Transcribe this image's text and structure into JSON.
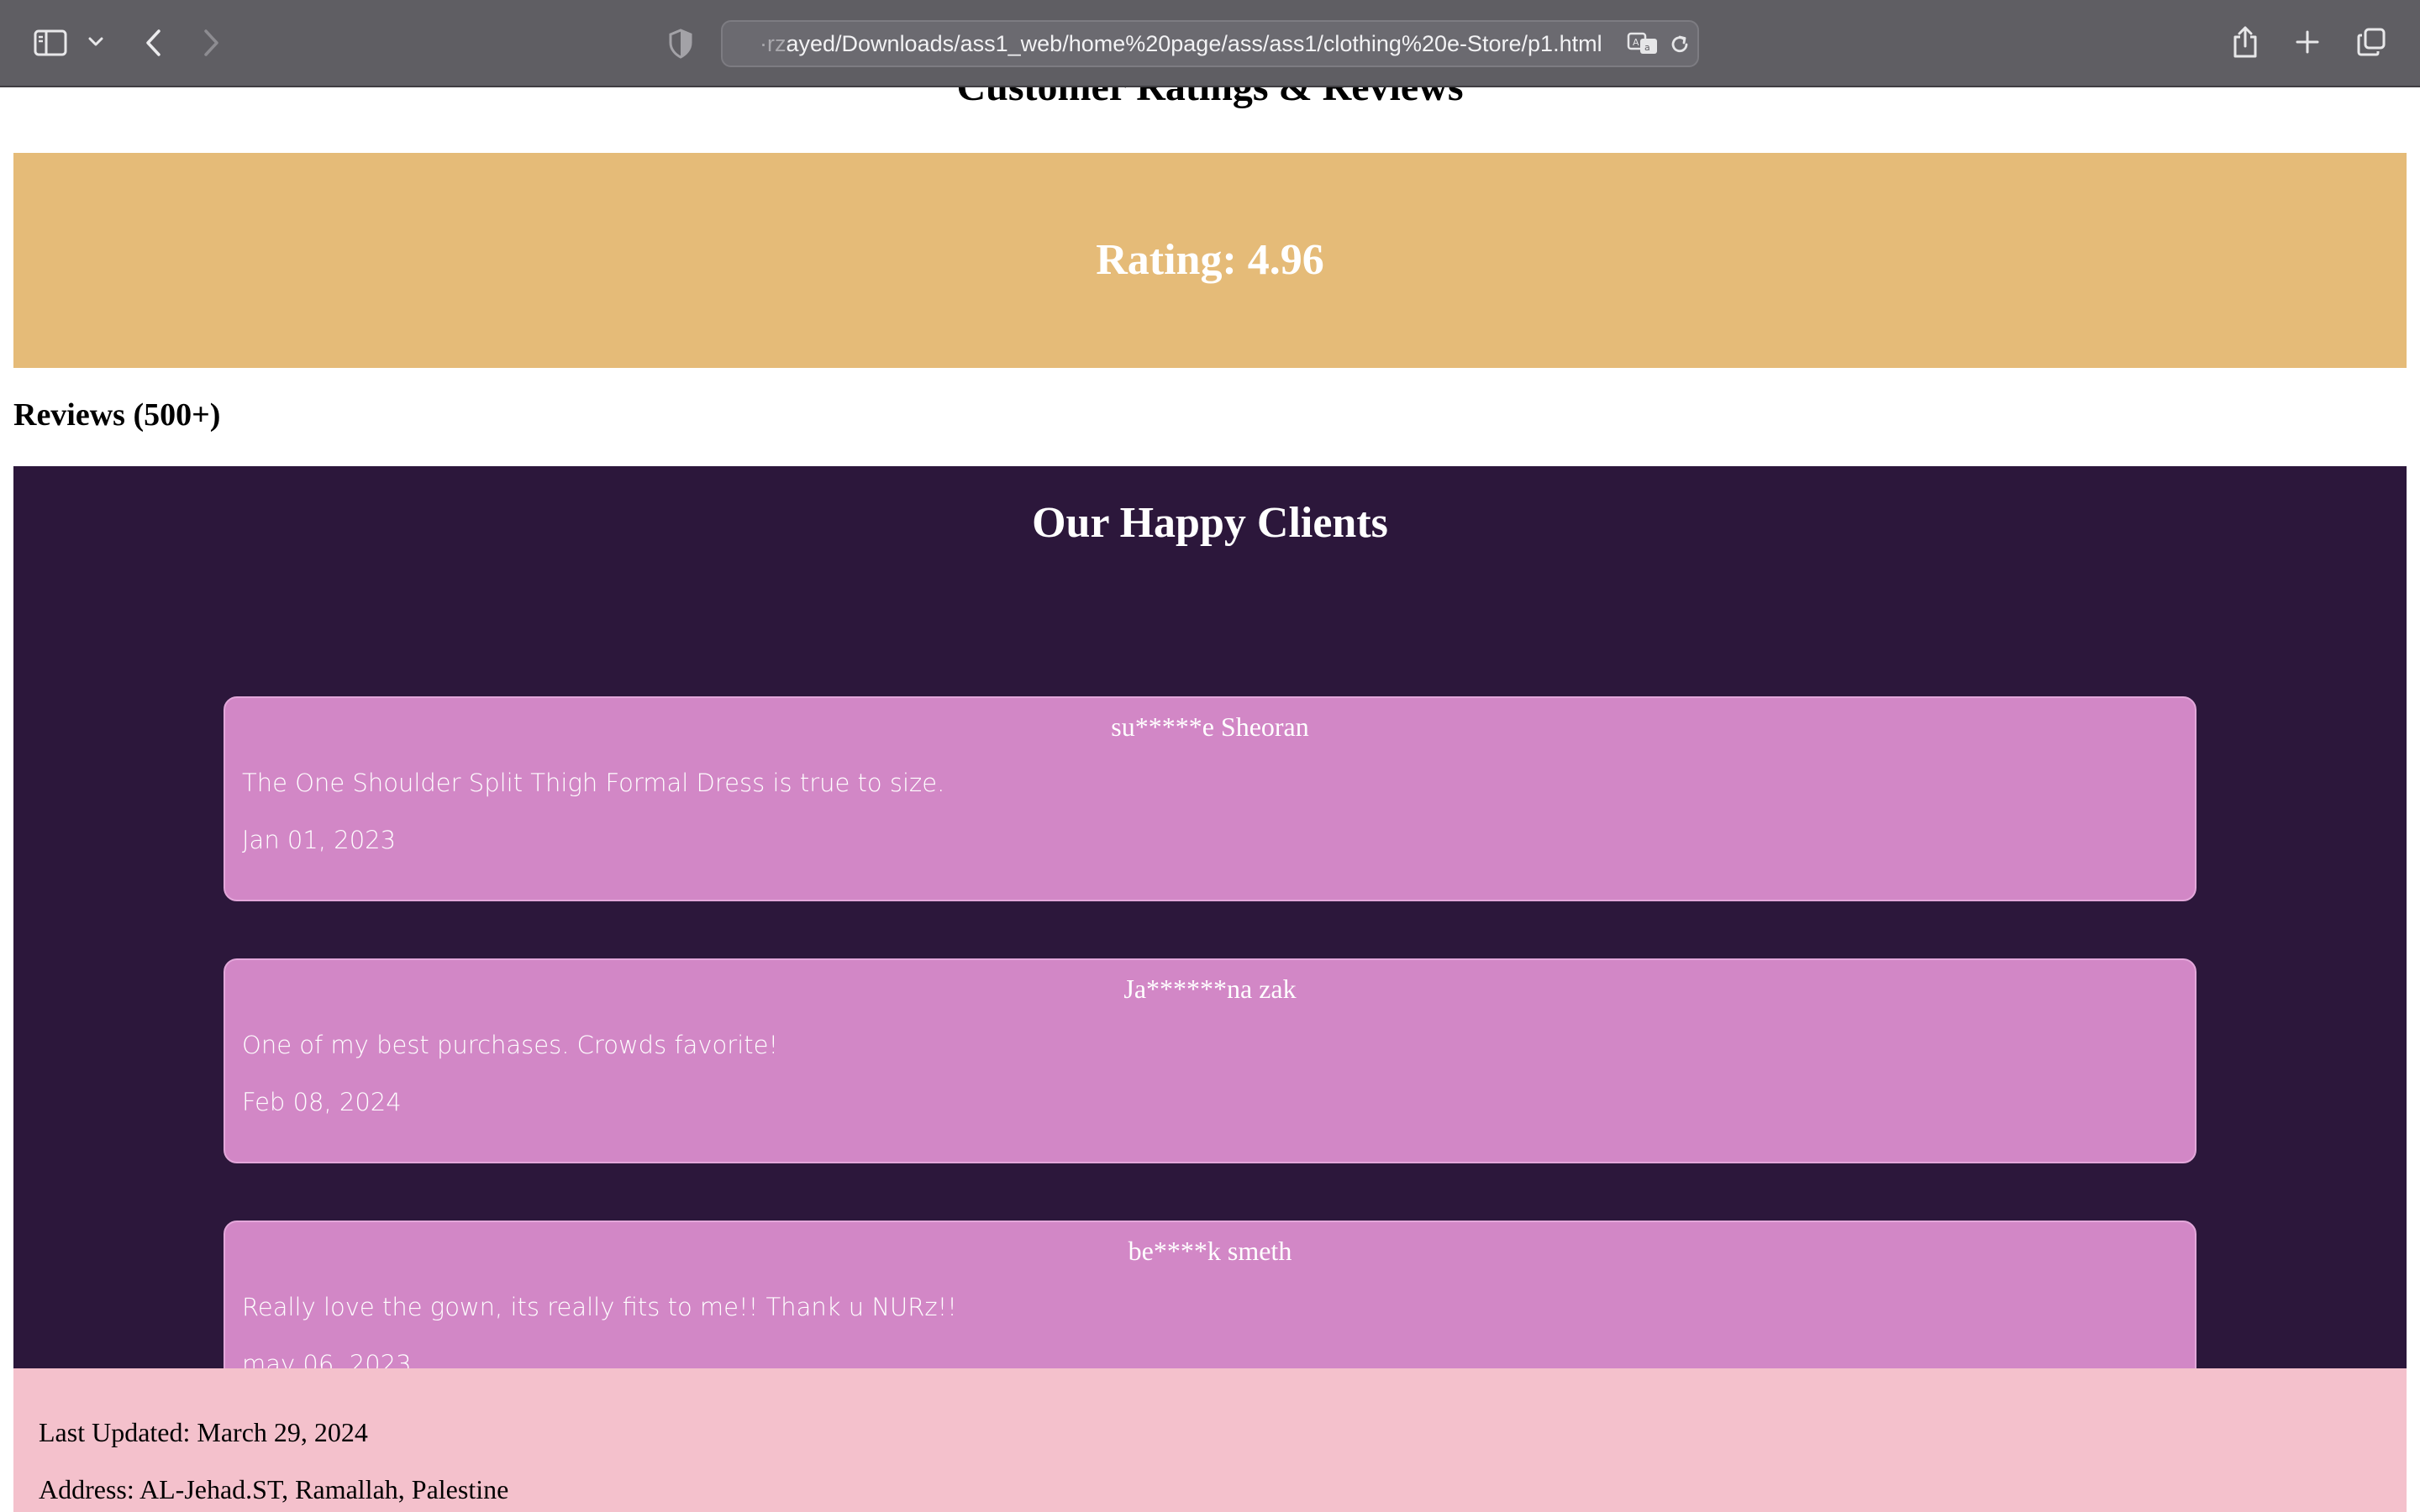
{
  "browser": {
    "url_faded": "·rz",
    "url": "ayed/Downloads/ass1_web/home%20page/ass/ass1/clothing%20e-Store/p1.html"
  },
  "page": {
    "section_title": "Customer Ratings & Reviews",
    "rating_text": "Rating: 4.96",
    "reviews_heading": "Reviews (500+)",
    "clients_title": "Our Happy Clients",
    "reviews": [
      {
        "name": "su*****e Sheoran",
        "text": "The One Shoulder Split Thigh Formal Dress is true to size.",
        "date": "Jan 01, 2023"
      },
      {
        "name": "Ja******na zak",
        "text": "One of my best purchases. Crowds favorite!",
        "date": "Feb 08, 2024"
      },
      {
        "name": "be****k smeth",
        "text": "Really love the gown, its really fits to me!! Thank u NURz!!",
        "date": "may 06, 2023"
      }
    ],
    "footer": {
      "last_updated": "Last Updated: March 29, 2024",
      "address": "Address: AL-Jehad.ST, Ramallah, Palestine"
    }
  },
  "colors": {
    "rating_band": "#e5bb78",
    "clients_panel": "#2c173b",
    "review_card": "#d287c6",
    "footer": "#f4c1cc"
  },
  "icons": [
    "sidebar-icon",
    "chevron-down-icon",
    "back-icon",
    "forward-icon",
    "privacy-shield-icon",
    "translate-icon",
    "reload-icon",
    "share-icon",
    "new-tab-icon",
    "tabs-overview-icon"
  ]
}
